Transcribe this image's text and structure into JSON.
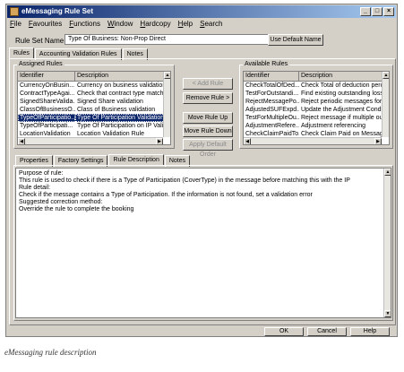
{
  "window": {
    "title": "eMessaging Rule Set"
  },
  "menu": [
    {
      "u": "F",
      "rest": "ile"
    },
    {
      "u": "F",
      "rest": "avourites"
    },
    {
      "u": "F",
      "rest": "unctions"
    },
    {
      "u": "W",
      "rest": "indow"
    },
    {
      "u": "H",
      "rest": "ardcopy"
    },
    {
      "u": "H",
      "rest": "elp"
    },
    {
      "u": "S",
      "rest": "earch"
    }
  ],
  "rule_set": {
    "label": "Rule Set Name",
    "value": "Type Of Business: Non-Prop Direct",
    "default_button": "Use Default Name"
  },
  "main_tabs": [
    "Rules",
    "Accounting Validation Rules",
    "Notes"
  ],
  "assigned": {
    "title": "Assigned Rules",
    "headers": [
      "Identifier",
      "Description"
    ],
    "rows": [
      [
        "CurrencyOnBusin...",
        "Currency on business validation"
      ],
      [
        "ContractTypeAgai...",
        "Check that contract type matche..."
      ],
      [
        "SignedShareValida...",
        "Signed Share validation"
      ],
      [
        "ClassOfBusinessO...",
        "Class of Business validation"
      ],
      [
        "TypeOfParticipatio...",
        "Type Of Participation Validation Rule"
      ],
      [
        "TypeOfParticipati...",
        "Type Of Participation on IP Valida..."
      ],
      [
        "LocationValidation",
        "Location Validation Rule"
      ]
    ],
    "selected_index": 4
  },
  "actions": {
    "add": "< Add Rule",
    "remove": "Remove Rule >",
    "up": "Move Rule Up",
    "down": "Move Rule Down",
    "apply_default": "Apply Default Order"
  },
  "available": {
    "title": "Available Rules",
    "headers": [
      "Identifier",
      "Description"
    ],
    "rows": [
      [
        "CheckTotalOfDed...",
        "Check Total of deduction percen"
      ],
      [
        "TestForOutstandi...",
        "Find existing outstanding losses"
      ],
      [
        "RejectMessagePo...",
        "Reject periodic messages for 'Ict'"
      ],
      [
        "AdjustedSUFExpd...",
        "Update the Adjustment Conditio"
      ],
      [
        "TestForMultipleOu...",
        "Reject message if multiple outsta"
      ],
      [
        "AdjustmentRefere...",
        "Adjustment referencing"
      ],
      [
        "CheckClaimPaidTo...",
        "Check Claim Paid on Message"
      ]
    ]
  },
  "sub_tabs": [
    "Properties",
    "Factory Settings",
    "Rule Description",
    "Notes"
  ],
  "description_lines": [
    "Purpose of rule:",
    "This rule is used to check if there is a Type of Participation (CoverType) in the message before matching this with the IP",
    "Rule detail:",
    "Check if the message contains a Type of Participation. If the information is not found, set a validation error",
    "Suggested correction method:",
    "Override the rule to complete the booking"
  ],
  "footer_buttons": [
    "OK",
    "Cancel",
    "Help"
  ],
  "caption": "eMessaging rule description"
}
